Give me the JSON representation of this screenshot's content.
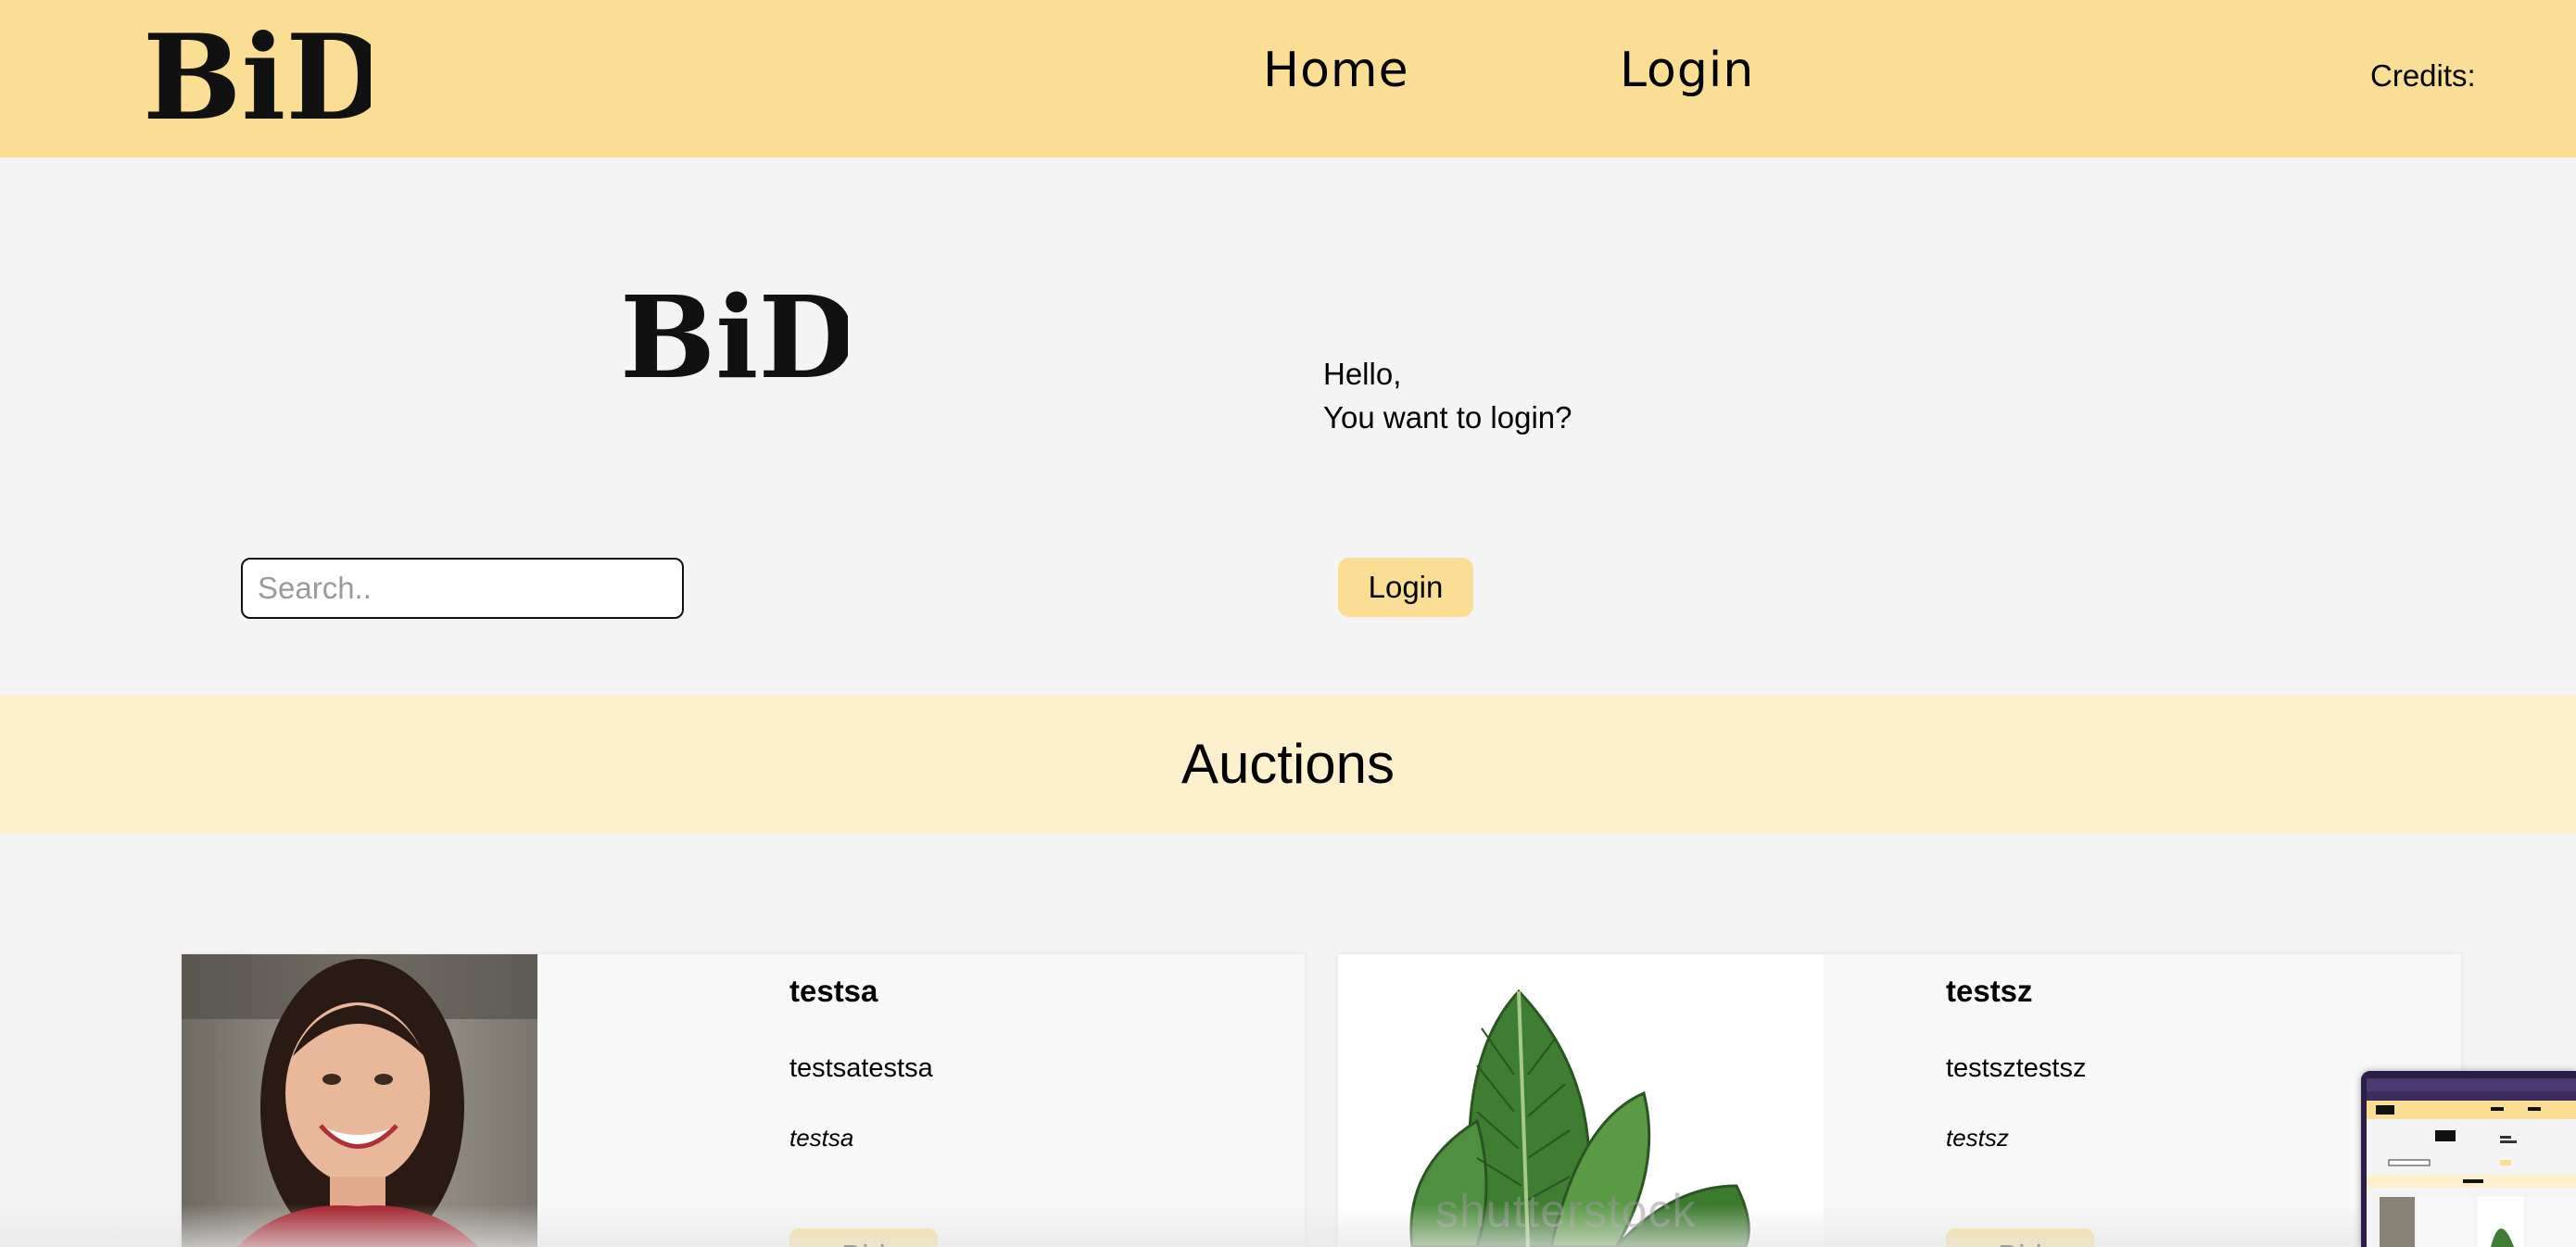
{
  "navbar": {
    "logo_text": "BiD",
    "links": [
      {
        "label": "Home"
      },
      {
        "label": "Login"
      }
    ],
    "credits_label": "Credits:"
  },
  "hero": {
    "logo_text": "BiD",
    "greeting_line1": "Hello,",
    "greeting_line2": "You want to login?",
    "search_placeholder": "Search..",
    "login_button": "Login"
  },
  "auctions": {
    "title": "Auctions",
    "items": [
      {
        "title": "testsa",
        "description": "testsatestsa",
        "user": "testsa",
        "bid_label": "Bid",
        "image": "portrait-photo"
      },
      {
        "title": "testsz",
        "description": "testsztestsz",
        "user": "testsz",
        "bid_label": "Bid",
        "image": "plant-leaf-illustration",
        "watermark": "shutterstock"
      }
    ]
  },
  "colors": {
    "navbar_bg": "#f9de94",
    "auctions_band_bg": "#fcf0cd",
    "page_bg": "#f4f4f4",
    "button_bg": "#f9de94"
  }
}
